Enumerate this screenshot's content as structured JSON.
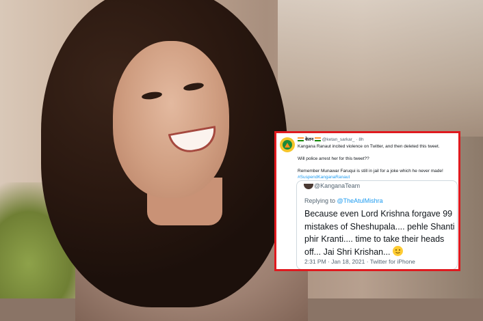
{
  "tweet": {
    "flag_left": "🇮🇳",
    "name": "केतन",
    "flag_right": "🇮🇳",
    "handle": "@ketan_sarkar_",
    "dot": "·",
    "age": "8h",
    "line1": "Kangana Ranaut incited violence on Twitter, and then deleted this tweet.",
    "line2": "Will police arrest her for this tweet??",
    "line3": "Remember Munawar Faruqui is still in jail for a joke which he never made!",
    "hashtag": "#SuspendKanganaRanaut"
  },
  "quoted": {
    "handle": "@KanganaTeam",
    "replying_prefix": "Replying to ",
    "replying_to": "@TheAtulMishra",
    "text": "Because even Lord Krishna forgave 99 mistakes of Sheshupala.... pehle Shanti phir Kranti.... time to take their heads off... Jai Shri Krishan... ",
    "emoji": "slightly-smiling-face-icon",
    "time": "2:31 PM · Jan 18, 2021 · Twitter for iPhone"
  },
  "colors": {
    "frame_border": "#e0191e",
    "link": "#1d9bf0",
    "muted": "#536471"
  }
}
